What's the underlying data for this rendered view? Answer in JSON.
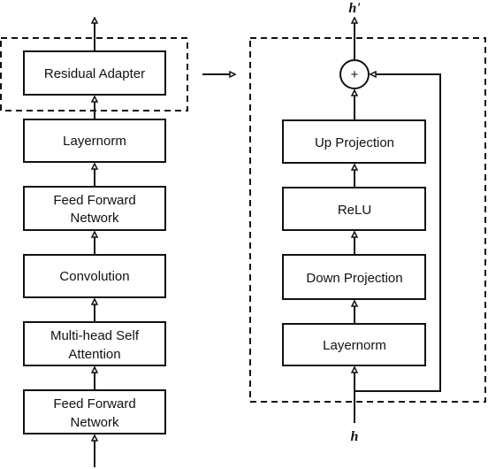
{
  "left_stack": {
    "residual_adapter": "Residual Adapter",
    "layernorm": "Layernorm",
    "ffn_top": [
      "Feed Forward",
      "Network"
    ],
    "convolution": "Convolution",
    "mhsa": [
      "Multi-head Self",
      "Attention"
    ],
    "ffn_bottom": [
      "Feed Forward",
      "Network"
    ]
  },
  "adapter_detail": {
    "output_label": "h'",
    "input_label": "h",
    "add_symbol": "+",
    "up_projection": "Up Projection",
    "relu": "ReLU",
    "down_projection": "Down Projection",
    "layernorm": "Layernorm"
  }
}
